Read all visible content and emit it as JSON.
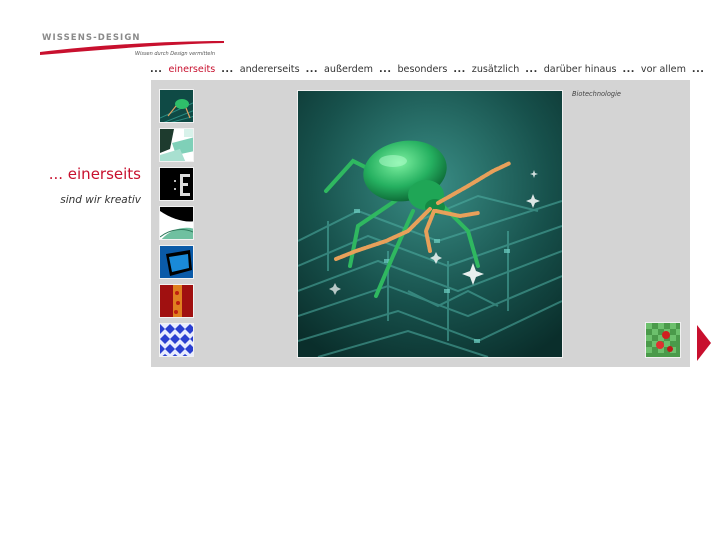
{
  "logo": {
    "brand": "WISSENS-DESIGN",
    "tagline": "Wissen durch Design vermitteln"
  },
  "nav": {
    "separator": "...",
    "items": [
      {
        "label": "einerseits",
        "active": true
      },
      {
        "label": "andererseits",
        "active": false
      },
      {
        "label": "außerdem",
        "active": false
      },
      {
        "label": "besonders",
        "active": false
      },
      {
        "label": "zusätzlich",
        "active": false
      },
      {
        "label": "darüber hinaus",
        "active": false
      },
      {
        "label": "vor allem",
        "active": false
      }
    ]
  },
  "headline": "... einerseits",
  "subline": "sind wir kreativ",
  "gallery": {
    "caption": "Biotechnologie",
    "thumbnails": [
      {
        "name": "thumb-beetle",
        "theme": "teal-circuit"
      },
      {
        "name": "thumb-abstract-green",
        "theme": "green-white"
      },
      {
        "name": "thumb-letter-e",
        "theme": "black-letter"
      },
      {
        "name": "thumb-curve",
        "theme": "black-green-curve"
      },
      {
        "name": "thumb-blue-screen",
        "theme": "blue-black"
      },
      {
        "name": "thumb-red-orange",
        "theme": "red-orange"
      },
      {
        "name": "thumb-checker",
        "theme": "blue-checker"
      }
    ]
  },
  "colors": {
    "accent": "#c8102e",
    "panel": "#d4d4d4",
    "image_bg": "#0d3e3a"
  }
}
